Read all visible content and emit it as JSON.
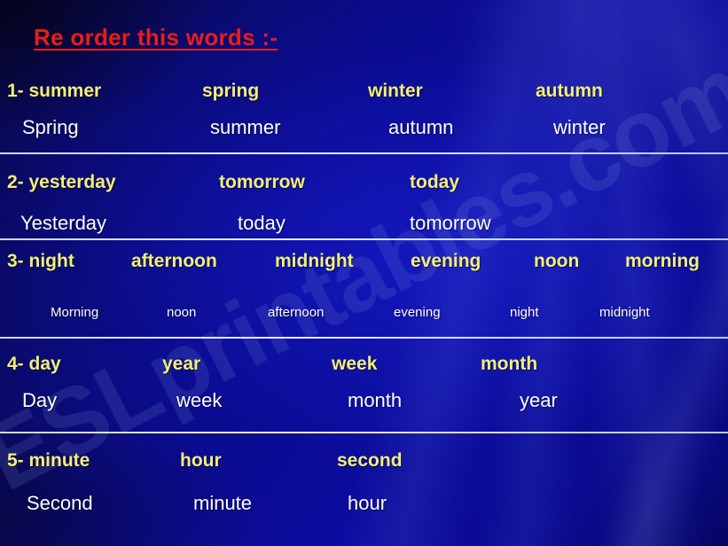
{
  "slide": {
    "title": "Re order this words :-",
    "title_color": "#ed1b18",
    "question_color": "#f2ee7a",
    "answer_color": "#ffffff",
    "background_color": "#0b0b86",
    "watermark": "ESLprintables.com"
  },
  "rows": [
    {
      "number": "1-",
      "questions": [
        "1- summer",
        "spring",
        "winter",
        "autumn"
      ],
      "answers": [
        "Spring",
        "summer",
        "autumn",
        "winter"
      ]
    },
    {
      "number": "2-",
      "questions": [
        "2- yesterday",
        "tomorrow",
        "today"
      ],
      "answers": [
        "Yesterday",
        "today",
        "tomorrow"
      ]
    },
    {
      "number": "3-",
      "questions": [
        "3- night",
        "afternoon",
        "midnight",
        "evening",
        "noon",
        "morning"
      ],
      "answers": [
        "Morning",
        "noon",
        "afternoon",
        "evening",
        "night",
        "midnight"
      ]
    },
    {
      "number": "4-",
      "questions": [
        "4- day",
        "year",
        "week",
        "month"
      ],
      "answers": [
        "Day",
        "week",
        "month",
        "year"
      ]
    },
    {
      "number": "5-",
      "questions": [
        "5- minute",
        "hour",
        "second"
      ],
      "answers": [
        "Second",
        "minute",
        "hour"
      ]
    }
  ]
}
